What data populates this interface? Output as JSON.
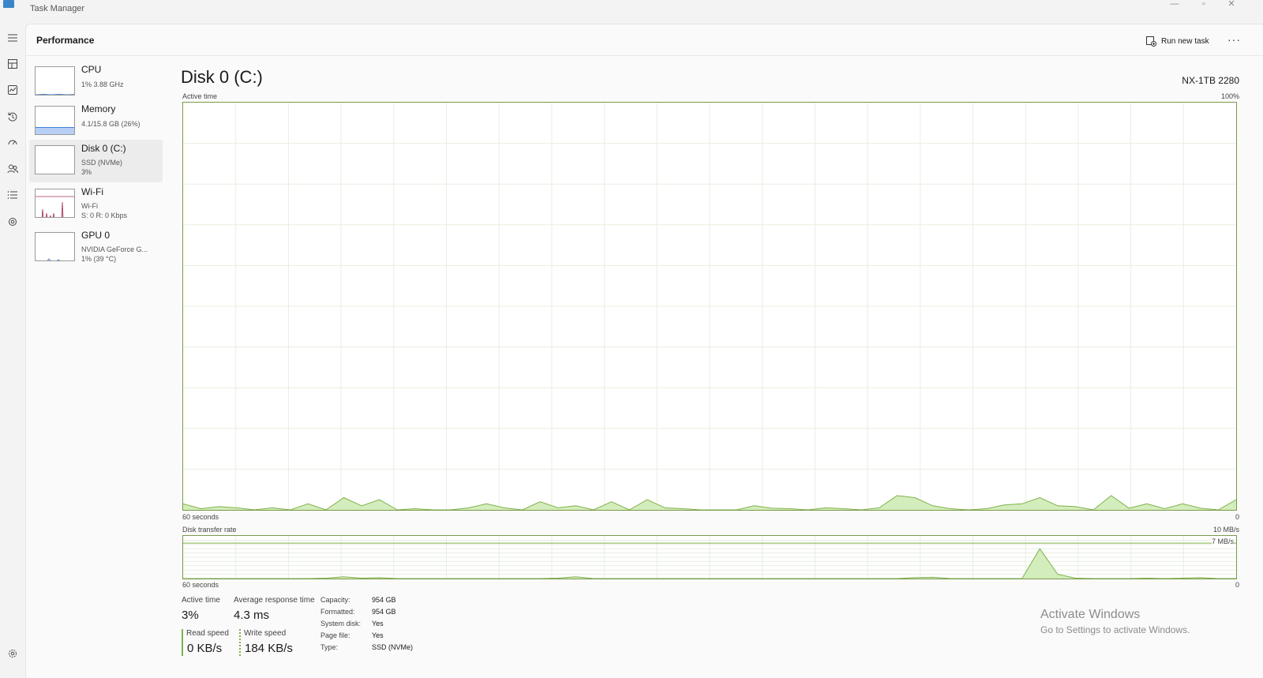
{
  "window": {
    "title": "Task Manager",
    "minimize": "—",
    "maximize": "▫",
    "close": "✕"
  },
  "header": {
    "title": "Performance",
    "run_new_task": "Run new task",
    "more": "···"
  },
  "rail": {
    "items": [
      "menu-icon",
      "processes-icon",
      "performance-icon",
      "app-history-icon",
      "startup-apps-icon",
      "users-icon",
      "details-icon",
      "services-icon",
      "settings-icon"
    ]
  },
  "devices": [
    {
      "name": "CPU",
      "line1": "1% 3.88 GHz",
      "line2": ""
    },
    {
      "name": "Memory",
      "line1": "4.1/15.8 GB (26%)",
      "line2": ""
    },
    {
      "name": "Disk 0 (C:)",
      "line1": "SSD (NVMe)",
      "line2": "3%"
    },
    {
      "name": "Wi-Fi",
      "line1": "Wi-Fi",
      "line2": "S: 0 R: 0 Kbps"
    },
    {
      "name": "GPU 0",
      "line1": "NVIDIA GeForce G...",
      "line2": "1% (39 °C)"
    }
  ],
  "detail": {
    "title": "Disk 0 (C:)",
    "model": "NX-1TB 2280",
    "chart1_label": "Active time",
    "chart1_max": "100%",
    "chart1_time": "60 seconds",
    "chart1_min": "0",
    "chart2_label": "Disk transfer rate",
    "chart2_max": "10 MB/s",
    "chart2_line_label": "7 MB/s",
    "chart2_time": "60 seconds",
    "chart2_min": "0"
  },
  "stats": {
    "active_time_label": "Active time",
    "active_time": "3%",
    "avg_response_label": "Average response time",
    "avg_response": "4.3 ms",
    "read_speed_label": "Read speed",
    "read_speed": "0 KB/s",
    "write_speed_label": "Write speed",
    "write_speed": "184 KB/s"
  },
  "info": [
    {
      "key": "Capacity:",
      "value": "954 GB"
    },
    {
      "key": "Formatted:",
      "value": "954 GB"
    },
    {
      "key": "System disk:",
      "value": "Yes"
    },
    {
      "key": "Page file:",
      "value": "Yes"
    },
    {
      "key": "Type:",
      "value": "SSD (NVMe)"
    }
  ],
  "watermark": {
    "line1": "Activate Windows",
    "line2": "Go to Settings to activate Windows."
  },
  "colors": {
    "disk_fill": "#d4edbc",
    "disk_line": "#7fb24a",
    "memory": "#b7cff5",
    "wifi": "#a0325a",
    "gpu": "#6a7fc4"
  },
  "chart_data": [
    {
      "type": "area",
      "ylabel": "Active time",
      "ylim": [
        0,
        100
      ],
      "x_span_seconds": 60,
      "grid": true,
      "series": [
        {
          "values": [
            1.5,
            0.3,
            0.8,
            0.5,
            0,
            0.5,
            0,
            1.5,
            0,
            3,
            1,
            2.5,
            0,
            0.3,
            0,
            0,
            0.5,
            1.5,
            0.5,
            0,
            2,
            0.5,
            1,
            0,
            2,
            0,
            2.5,
            0.5,
            0.3,
            0,
            0,
            0,
            1,
            0.4,
            0.3,
            0,
            0.5,
            0.3,
            0,
            0.5,
            3.5,
            3,
            1,
            0.3,
            0,
            0.3,
            1.2,
            1.5,
            3,
            1,
            0.8,
            0,
            3.5,
            0.4,
            1.5,
            0.3,
            1.5,
            0.4,
            0,
            2.5
          ]
        }
      ]
    },
    {
      "type": "area",
      "ylabel": "Disk transfer rate",
      "ylim": [
        0,
        10
      ],
      "x_span_seconds": 60,
      "grid": true,
      "series": [
        {
          "values": [
            0,
            0,
            0,
            0,
            0,
            0,
            0,
            0,
            0.1,
            0.4,
            0.1,
            0.2,
            0,
            0,
            0,
            0,
            0,
            0,
            0,
            0,
            0,
            0.1,
            0.4,
            0,
            0,
            0,
            0,
            0,
            0,
            0,
            0,
            0,
            0,
            0,
            0,
            0,
            0,
            0,
            0,
            0,
            0,
            0.2,
            0.3,
            0,
            0,
            0,
            0,
            0,
            7,
            1,
            0.1,
            0,
            0,
            0,
            0.1,
            0,
            0.1,
            0.2,
            0,
            0
          ]
        }
      ]
    }
  ]
}
